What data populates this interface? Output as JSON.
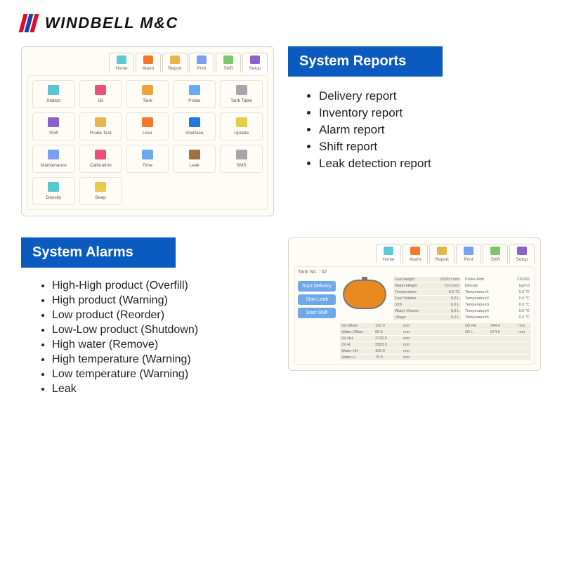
{
  "brand": {
    "text": "WINDBELL M&C",
    "colors": [
      "#d6122a",
      "#1f3fb5"
    ]
  },
  "tabs": [
    {
      "label": "Home",
      "color": "#5dc9d6"
    },
    {
      "label": "Alarm",
      "color": "#f07a2a"
    },
    {
      "label": "Report",
      "color": "#e7b64a"
    },
    {
      "label": "Print",
      "color": "#7a9ff0"
    },
    {
      "label": "Shift",
      "color": "#7bc86c"
    },
    {
      "label": "Setup",
      "color": "#8a62c9"
    }
  ],
  "setup_tiles": [
    {
      "label": "Station",
      "color": "#59c5d1"
    },
    {
      "label": "Oil",
      "color": "#e94f7a"
    },
    {
      "label": "Tank",
      "color": "#f0a23a"
    },
    {
      "label": "Probe",
      "color": "#6aa9f0"
    },
    {
      "label": "Tank Table",
      "color": "#a6a6a6"
    },
    {
      "label": "Shift",
      "color": "#8a62c9"
    },
    {
      "label": "Probe Test",
      "color": "#e7b64a"
    },
    {
      "label": "User",
      "color": "#f07a2a"
    },
    {
      "label": "Interface",
      "color": "#1f7ae0"
    },
    {
      "label": "Update",
      "color": "#e8c94a"
    },
    {
      "label": "Maintenance",
      "color": "#7a9ff0"
    },
    {
      "label": "Calibration",
      "color": "#e94f7a"
    },
    {
      "label": "Time",
      "color": "#6aa9f0"
    },
    {
      "label": "Leak",
      "color": "#9c7240"
    },
    {
      "label": "SMS",
      "color": "#a6a6a6"
    },
    {
      "label": "Density",
      "color": "#59c5d1"
    },
    {
      "label": "Beep",
      "color": "#e8c94a"
    }
  ],
  "sections": {
    "reports": {
      "heading": "System Reports",
      "items": [
        "Delivery report",
        "Inventory report",
        "Alarm report",
        "Shift report",
        "Leak detection report"
      ]
    },
    "alarms": {
      "heading": "System Alarms",
      "items": [
        "High-High product (Overfill)",
        "High product (Warning)",
        "Low product (Reorder)",
        "Low-Low product (Shutdown)",
        "High water (Remove)",
        "High temperature (Warning)",
        "Low temperature (Warning)",
        "Leak"
      ]
    }
  },
  "home": {
    "tank_label": "Tank No. :",
    "tank_no": "02",
    "buttons": {
      "start_delivery": "Start Delivery",
      "start_leak": "Start Leak",
      "start_shift": "Start Shift"
    },
    "readouts_left": [
      {
        "k": "Fuel Height",
        "v": "2000.0",
        "u": "mm"
      },
      {
        "k": "Water Height",
        "v": "10.0",
        "u": "mm"
      },
      {
        "k": "Temperature",
        "v": "0.0",
        "u": "℃"
      },
      {
        "k": "Fuel Volume",
        "v": "0.0",
        "u": "L"
      },
      {
        "k": "V20",
        "v": "0.0",
        "u": "L"
      },
      {
        "k": "Water Volume",
        "v": "0.0",
        "u": "L"
      },
      {
        "k": "Ullage",
        "v": "0.0",
        "u": "L"
      }
    ],
    "readouts_right": [
      {
        "k": "Probe Addr",
        "v": "210282",
        "u": ""
      },
      {
        "k": "Density",
        "v": "",
        "u": "kg/m3"
      },
      {
        "k": "Temperature1",
        "v": "0.0",
        "u": "℃"
      },
      {
        "k": "Temperature2",
        "v": "0.0",
        "u": "℃"
      },
      {
        "k": "Temperature3",
        "v": "0.0",
        "u": "℃"
      },
      {
        "k": "Temperature4",
        "v": "0.0",
        "u": "℃"
      },
      {
        "k": "Temperature5",
        "v": "0.0",
        "u": "℃"
      }
    ],
    "offsets": [
      {
        "k": "Oil Offset",
        "v": "120.0",
        "u": "mm",
        "k2": "Oil HH",
        "v2": "344.4",
        "u2": "mm"
      },
      {
        "k": "Water Offset",
        "v": "60.0",
        "u": "mm",
        "k2": "Oil L",
        "v2": "574.0",
        "u2": "mm"
      },
      {
        "k": "Oil HH",
        "v": "2726.5",
        "u": "mm"
      },
      {
        "k": "Oil H",
        "v": "2583.0",
        "u": "mm"
      },
      {
        "k": "Water HH",
        "v": "100.0",
        "u": "mm"
      },
      {
        "k": "Water H",
        "v": "75.0",
        "u": "mm"
      }
    ]
  }
}
